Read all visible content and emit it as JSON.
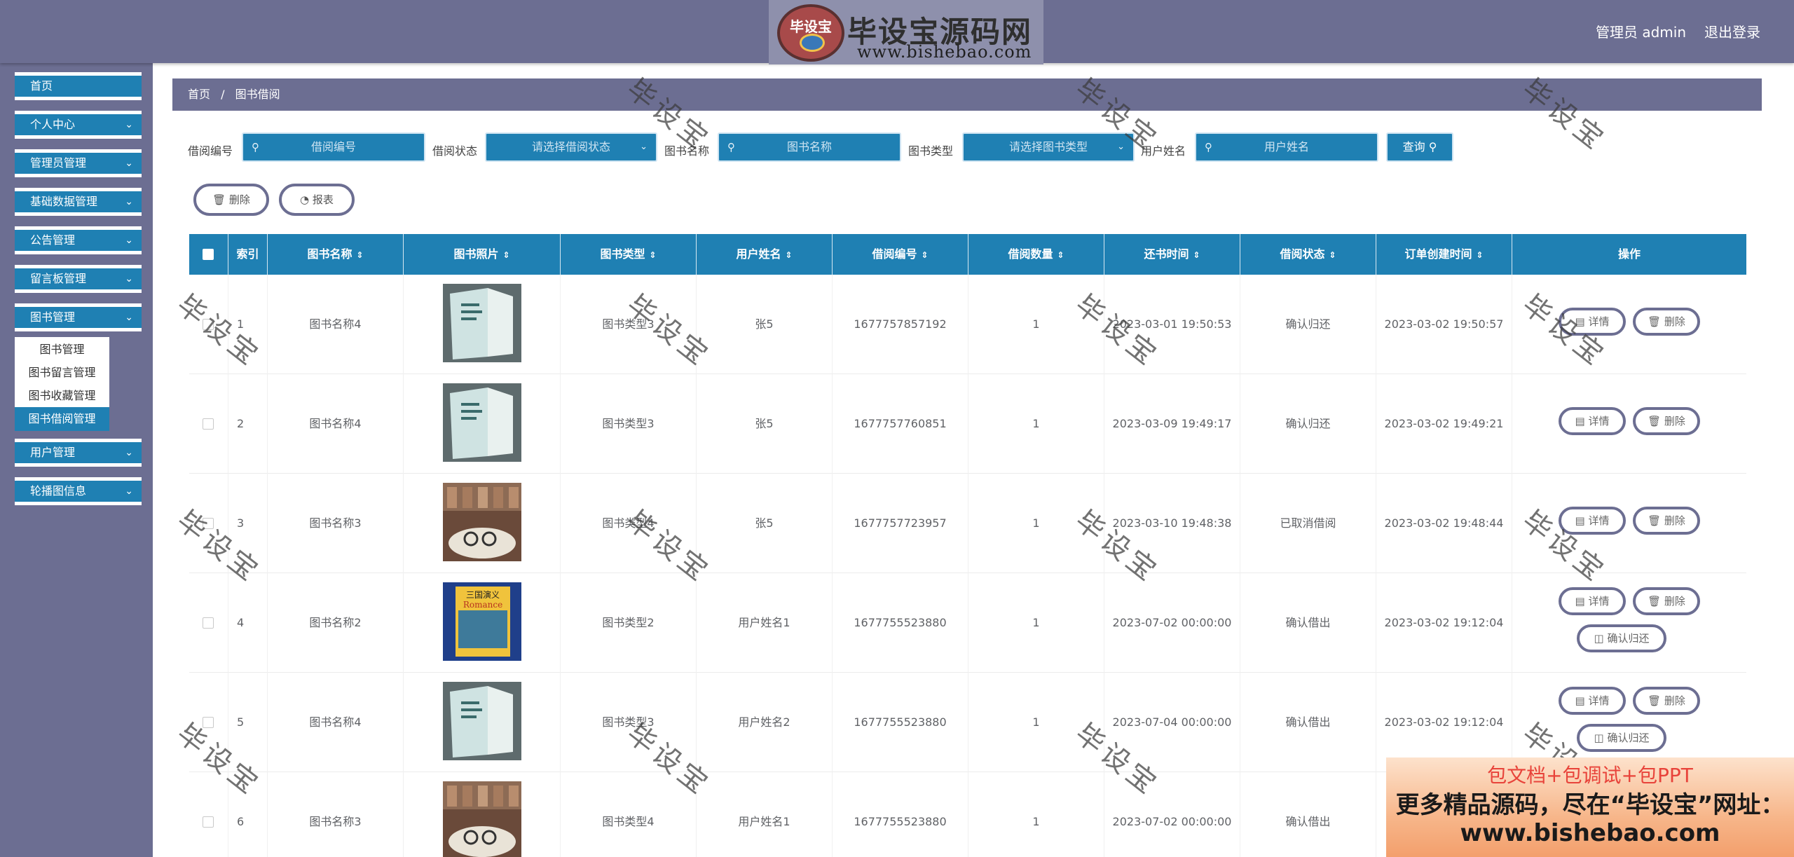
{
  "header": {
    "logo_mark": "毕设宝",
    "logo_title": "毕设宝源码网",
    "logo_url": "www.bishebao.com",
    "admin": "管理员 admin",
    "logout": "退出登录"
  },
  "sidebar": {
    "items": [
      {
        "label": "首页",
        "chevron": false
      },
      {
        "label": "个人中心",
        "chevron": true
      },
      {
        "label": "管理员管理",
        "chevron": true
      },
      {
        "label": "基础数据管理",
        "chevron": true
      },
      {
        "label": "公告管理",
        "chevron": true
      },
      {
        "label": "留言板管理",
        "chevron": true
      },
      {
        "label": "图书管理",
        "chevron": true
      },
      {
        "label": "用户管理",
        "chevron": true
      },
      {
        "label": "轮播图信息",
        "chevron": true
      }
    ],
    "submenu": [
      "图书管理",
      "图书留言管理",
      "图书收藏管理"
    ],
    "active_sub": "图书借阅管理"
  },
  "breadcrumb": {
    "home": "首页",
    "separator": "/",
    "current": "图书借阅"
  },
  "filters": {
    "borrow_no_label": "借阅编号",
    "borrow_no_placeholder": "借阅编号",
    "borrow_status_label": "借阅状态",
    "borrow_status_placeholder": "请选择借阅状态",
    "book_name_label": "图书名称",
    "book_name_placeholder": "图书名称",
    "book_type_label": "图书类型",
    "book_type_placeholder": "请选择图书类型",
    "user_name_label": "用户姓名",
    "user_name_placeholder": "用户姓名",
    "query_label": "查询"
  },
  "toolbar": {
    "delete_label": "删除",
    "report_label": "报表"
  },
  "table": {
    "columns": [
      "索引",
      "图书名称",
      "图书照片",
      "图书类型",
      "用户姓名",
      "借阅编号",
      "借阅数量",
      "还书时间",
      "借阅状态",
      "订单创建时间",
      "操作"
    ],
    "rows": [
      {
        "index": "1",
        "book_name": "图书名称4",
        "book_type": "图书类型3",
        "user": "张5",
        "borrow_no": "1677757857192",
        "qty": "1",
        "return_time": "2023-03-01 19:50:53",
        "status": "确认归还",
        "created": "2023-03-02 19:50:57",
        "photo": "teal"
      },
      {
        "index": "2",
        "book_name": "图书名称4",
        "book_type": "图书类型3",
        "user": "张5",
        "borrow_no": "1677757760851",
        "qty": "1",
        "return_time": "2023-03-09 19:49:17",
        "status": "确认归还",
        "created": "2023-03-02 19:49:21",
        "photo": "teal"
      },
      {
        "index": "3",
        "book_name": "图书名称3",
        "book_type": "图书类型4",
        "user": "张5",
        "borrow_no": "1677757723957",
        "qty": "1",
        "return_time": "2023-03-10 19:48:38",
        "status": "已取消借阅",
        "created": "2023-03-02 19:48:44",
        "photo": "library"
      },
      {
        "index": "4",
        "book_name": "图书名称2",
        "book_type": "图书类型2",
        "user": "用户姓名1",
        "borrow_no": "1677755523880",
        "qty": "1",
        "return_time": "2023-07-02 00:00:00",
        "status": "确认借出",
        "created": "2023-03-02 19:12:04",
        "photo": "romance"
      },
      {
        "index": "5",
        "book_name": "图书名称4",
        "book_type": "图书类型3",
        "user": "用户姓名2",
        "borrow_no": "1677755523880",
        "qty": "1",
        "return_time": "2023-07-04 00:00:00",
        "status": "确认借出",
        "created": "2023-03-02 19:12:04",
        "photo": "teal"
      },
      {
        "index": "6",
        "book_name": "图书名称3",
        "book_type": "图书类型4",
        "user": "用户姓名1",
        "borrow_no": "1677755523880",
        "qty": "1",
        "return_time": "2023-07-02 00:00:00",
        "status": "确认借出",
        "created": "",
        "photo": "library"
      }
    ],
    "actions": {
      "detail": "详情",
      "delete": "删除",
      "confirm_return": "确认归还"
    },
    "cover_text": {
      "romance_cn": "三国演义",
      "romance_en": "Romance"
    }
  },
  "watermark": "毕设宝",
  "ad": {
    "line1": "包文档+包调试+包PPT",
    "line2": "更多精品源码，尽在“毕设宝”网址：",
    "line3": "www.bishebao.com"
  },
  "colors": {
    "primary": "#1f80b3",
    "frame": "#6c6e92"
  }
}
